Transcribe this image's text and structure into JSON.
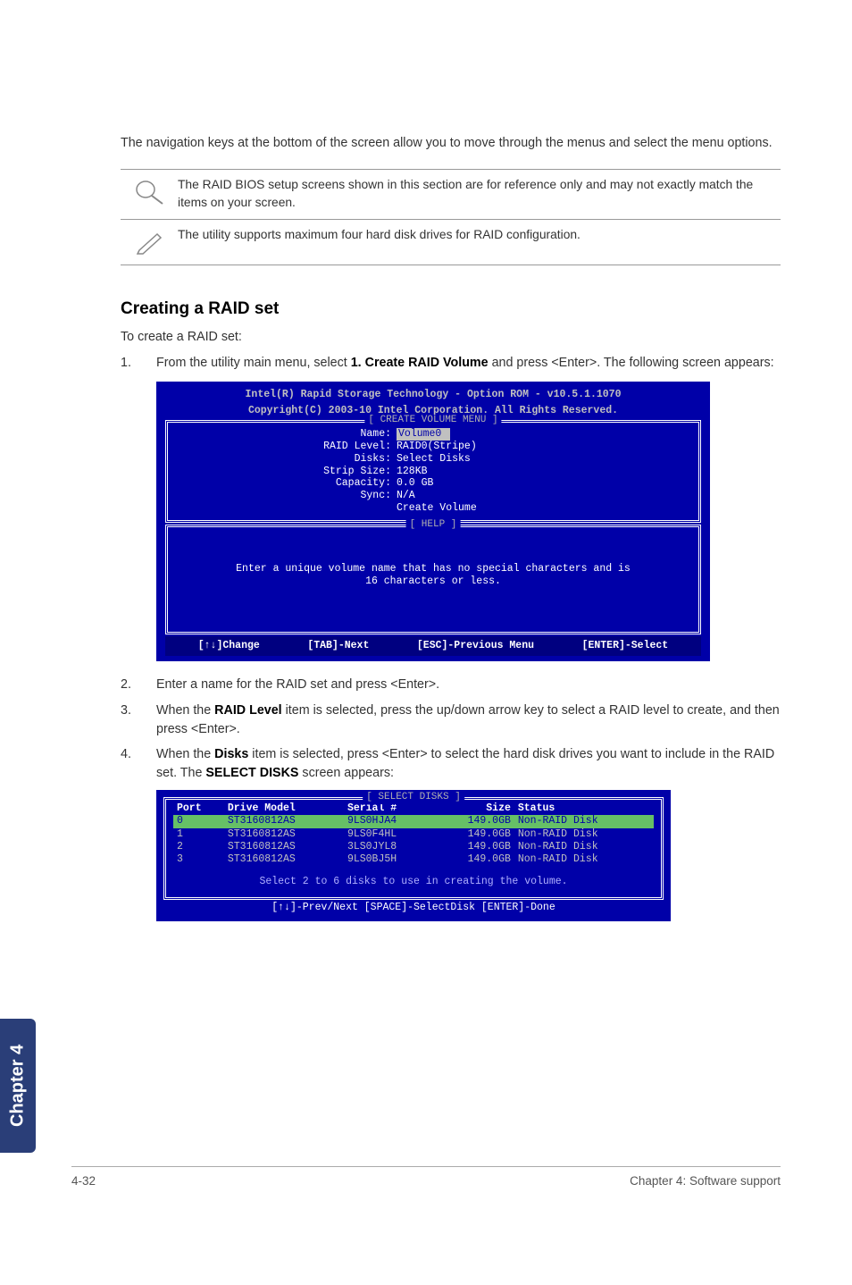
{
  "intro": "The navigation keys at the bottom of the screen allow you to move through the menus and select the menu options.",
  "notes": {
    "n1": "The RAID BIOS setup screens shown in this section are for reference only and may not exactly match the items on your screen.",
    "n2": "The utility supports maximum four hard disk drives for RAID configuration."
  },
  "heading": "Creating a RAID set",
  "subhead": "To create a RAID set:",
  "steps": {
    "s1a": "From the utility main menu, select ",
    "s1b": "1. Create RAID Volume",
    "s1c": " and press <Enter>. The following screen appears:",
    "s2": "Enter a name for the RAID set and press <Enter>.",
    "s3a": "When the ",
    "s3b": "RAID Level",
    "s3c": " item is selected, press the up/down arrow key to select a RAID level to create, and then press <Enter>.",
    "s4a": "When the ",
    "s4b": "Disks",
    "s4c": " item is selected, press <Enter> to select the hard disk drives you want to include in the RAID set. The ",
    "s4d": "SELECT DISKS",
    "s4e": " screen appears:"
  },
  "bios1": {
    "hdr1": "Intel(R) Rapid Storage Technology - Option ROM - v10.5.1.1070",
    "hdr2": "Copyright(C) 2003-10 Intel Corporation.  All Rights Reserved.",
    "boxTitle": "[ CREATE VOLUME MENU ]",
    "rows": {
      "l1": "Name:",
      "v1": "Volume0",
      "l2": "RAID Level:",
      "v2": "RAID0(Stripe)",
      "l3": "Disks:",
      "v3": "Select Disks",
      "l4": "Strip Size:",
      "v4": "128KB",
      "l5": "Capacity:",
      "v5": "0.0   GB",
      "l6": "Sync:",
      "v6": "N/A",
      "l7": "",
      "v7": "Create Volume"
    },
    "helpTitle": "[ HELP ]",
    "helpMsg1": "Enter a unique volume name that has no special characters and is",
    "helpMsg2": "16 characters or less.",
    "nav": {
      "a": "[↑↓]Change",
      "b": "[TAB]-Next",
      "c": "[ESC]-Previous Menu",
      "d": "[ENTER]-Select"
    }
  },
  "bios2": {
    "boxTitle": "[ SELECT DISKS ]",
    "headers": {
      "c1": "Port",
      "c2": "Drive Model",
      "c3": "Serial #",
      "c4": "Size",
      "c5": "Status"
    },
    "rows": [
      {
        "port": "0",
        "model": "ST3160812AS",
        "serial": "9LS0HJA4",
        "size": "149.0GB",
        "status": "Non-RAID Disk"
      },
      {
        "port": "1",
        "model": "ST3160812AS",
        "serial": "9LS0F4HL",
        "size": "149.0GB",
        "status": "Non-RAID Disk"
      },
      {
        "port": "2",
        "model": "ST3160812AS",
        "serial": "3LS0JYL8",
        "size": "149.0GB",
        "status": "Non-RAID Disk"
      },
      {
        "port": "3",
        "model": "ST3160812AS",
        "serial": "9LS0BJ5H",
        "size": "149.0GB",
        "status": "Non-RAID Disk"
      }
    ],
    "msg": "Select 2 to 6 disks to use in creating the volume.",
    "btm": "[↑↓]-Prev/Next [SPACE]-SelectDisk [ENTER]-Done"
  },
  "tab": "Chapter 4",
  "footer": {
    "left": "4-32",
    "right": "Chapter 4: Software support"
  }
}
